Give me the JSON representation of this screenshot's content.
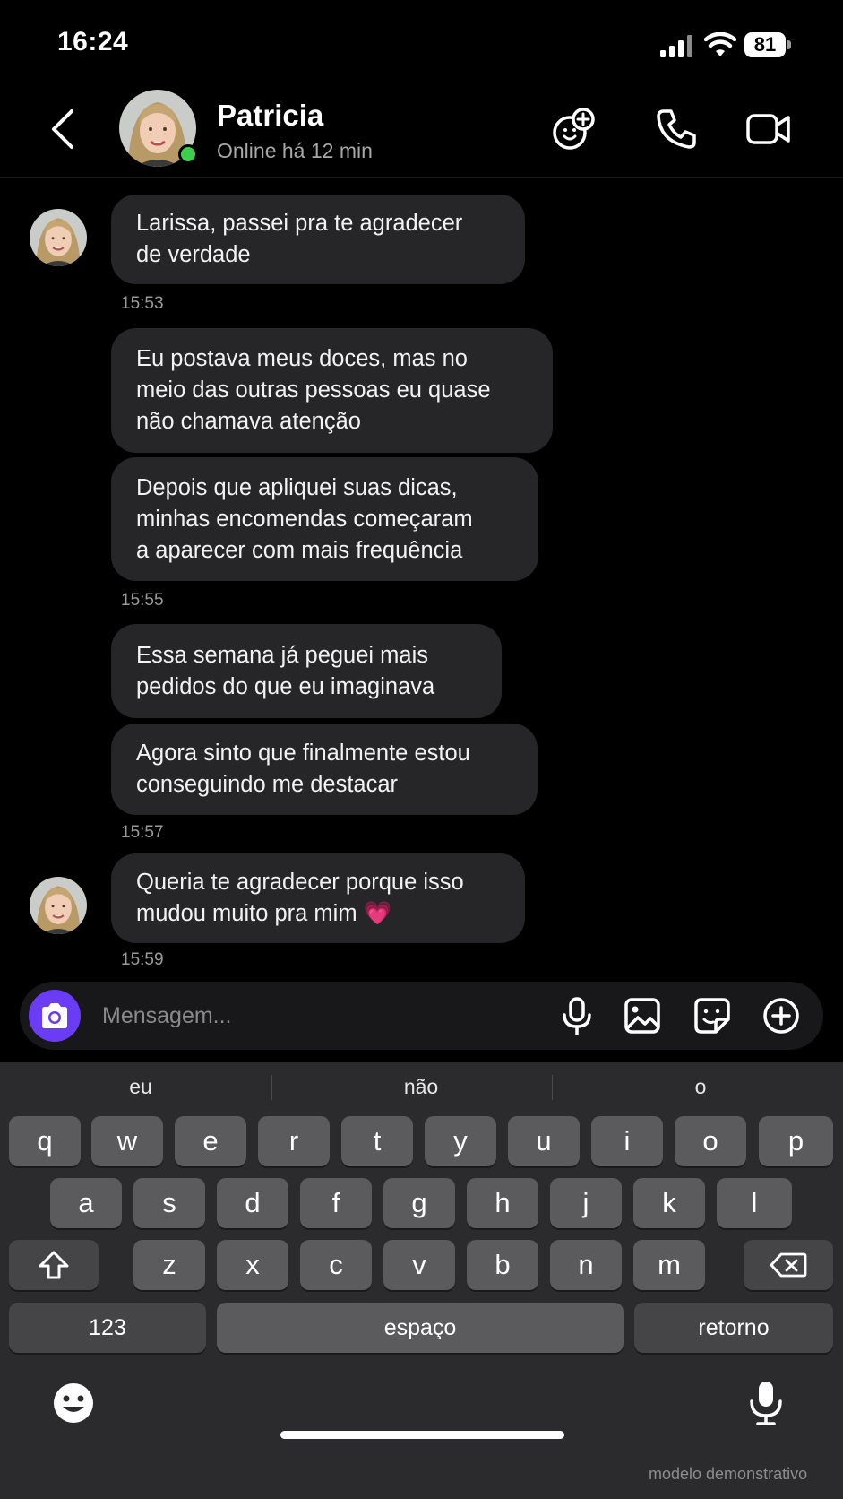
{
  "status_bar": {
    "time": "16:24",
    "battery": "81"
  },
  "header": {
    "contact_name": "Patricia",
    "contact_status": "Online há 12 min",
    "icons": [
      "back-icon",
      "add-sticker-icon",
      "phone-icon",
      "video-icon"
    ]
  },
  "messages": [
    {
      "text": "Larissa, passei pra te agradecer\nde verdade",
      "time": "15:53"
    },
    {
      "text": "Eu postava meus doces, mas no\nmeio das outras pessoas eu quase\nnão chamava atenção"
    },
    {
      "text": "Depois que apliquei suas dicas,\nminhas encomendas começaram\na aparecer com mais frequência",
      "time": "15:55"
    },
    {
      "text": "Essa semana já peguei mais\npedidos do que eu imaginava"
    },
    {
      "text": "Agora sinto que finalmente estou\nconseguindo me destacar",
      "time": "15:57"
    },
    {
      "text": "Queria te agradecer porque isso\nmudou muito pra mim 💗",
      "time": "15:59"
    }
  ],
  "composer": {
    "placeholder": "Mensagem..."
  },
  "keyboard": {
    "suggestions": [
      "eu",
      "não",
      "o"
    ],
    "row1": [
      "q",
      "w",
      "e",
      "r",
      "t",
      "y",
      "u",
      "i",
      "o",
      "p"
    ],
    "row2": [
      "a",
      "s",
      "d",
      "f",
      "g",
      "h",
      "j",
      "k",
      "l"
    ],
    "row3": [
      "z",
      "x",
      "c",
      "v",
      "b",
      "n",
      "m"
    ],
    "numbers_key": "123",
    "space_key": "espaço",
    "return_key": "retorno"
  },
  "watermark": "modelo demonstrativo",
  "colors": {
    "accent": "#6b3cf5",
    "online": "#3ccf4e",
    "bubble": "#262629"
  }
}
